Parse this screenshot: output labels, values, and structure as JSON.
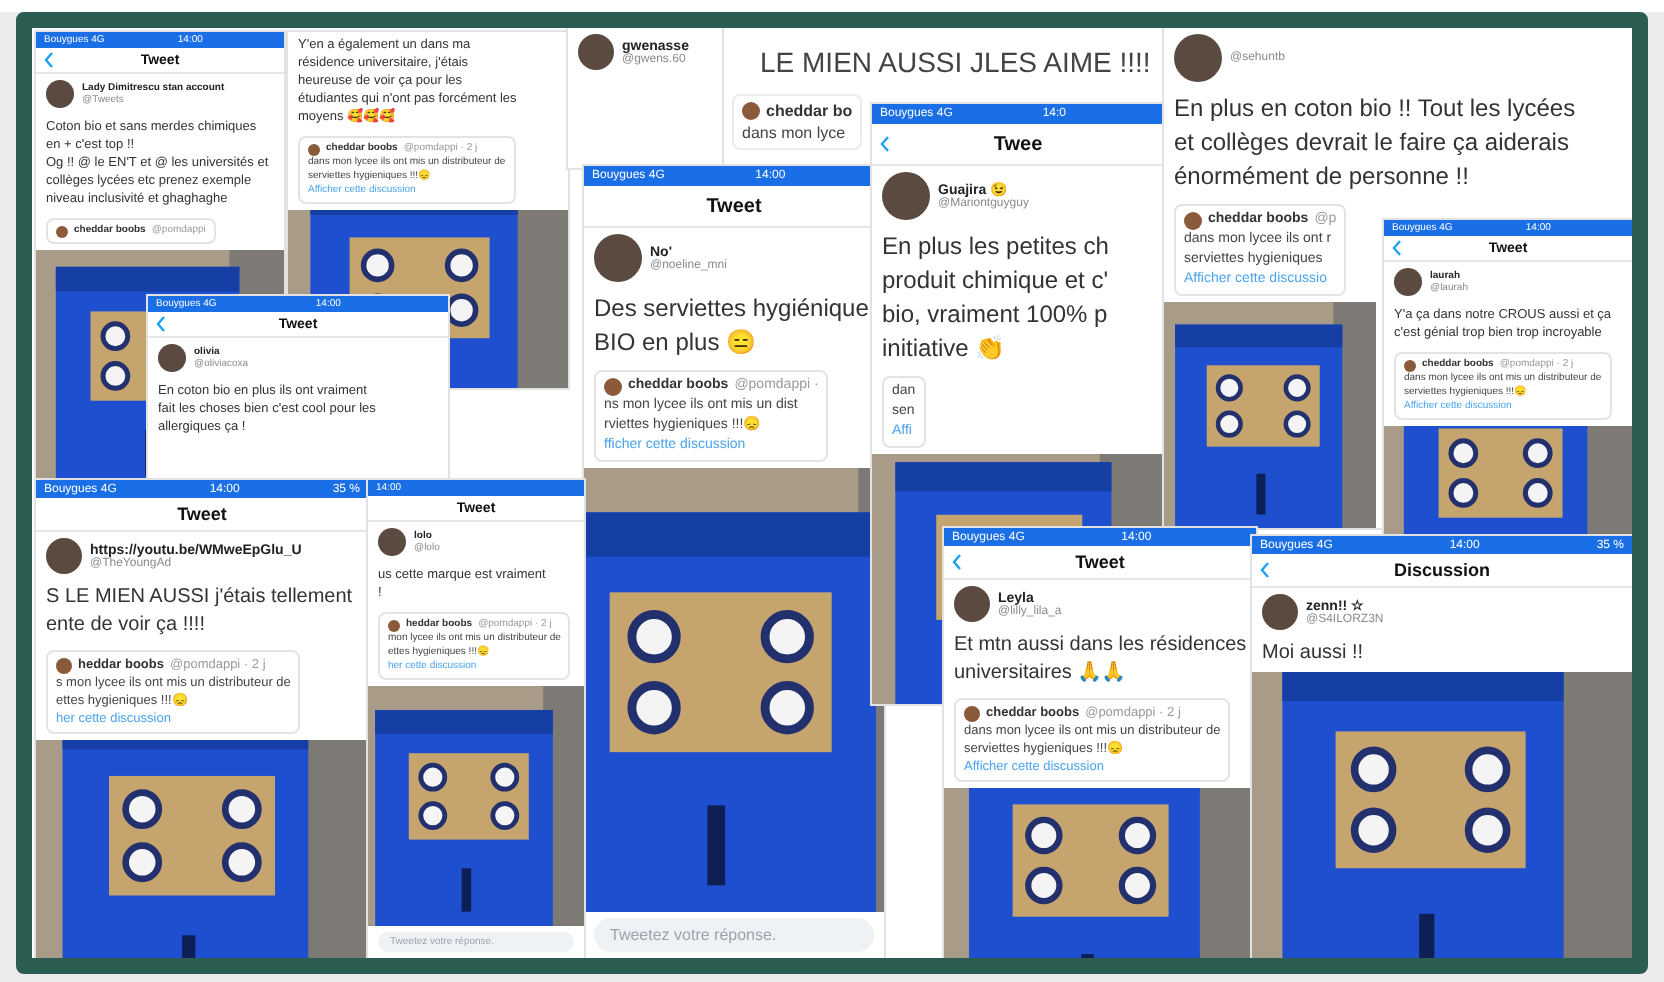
{
  "screenshots": [
    {
      "status": {
        "carrier": "Bouygues 4G",
        "time": "14:00"
      },
      "header": {
        "title": "Tweet",
        "back": true
      },
      "author": {
        "name": "Lady Dimitrescu stan account",
        "handle": "@Tweets"
      },
      "body": [
        "Coton bio et sans merdes chimiques",
        "en + c'est top !!",
        "Og !! @ le EN'T et @ les universités et",
        "collèges lycées etc prenez exemple",
        "niveau inclusivité et ghaghaghe"
      ],
      "quote": {
        "name": "cheddar boobs",
        "handle": "@pomdappi"
      },
      "photo": {
        "kind": "picture"
      }
    },
    {
      "body": [
        "Y'en a également un dans ma",
        "résidence universitaire, j'étais",
        "heureuse de voir ça pour les",
        "étudiantes qui n'ont pas forcément les",
        "moyens 🥰🥰🥰"
      ],
      "quote": {
        "name": "cheddar boobs",
        "handle": "@pomdappi · 2 j",
        "lines": [
          "dans mon lycee ils ont mis un distributeur de",
          "serviettes hygieniques !!!😞"
        ],
        "link": "Afficher cette discussion"
      },
      "photo": {
        "kind": "picture"
      }
    },
    {
      "author": {
        "name": "gwenasse",
        "handle": "@gwens.60"
      }
    },
    {
      "body": [
        "LE MIEN AUSSI JLES AIME !!!!"
      ],
      "quote": {
        "name": "cheddar bo",
        "lines": [
          "dans mon lyce"
        ]
      }
    },
    {
      "status": {
        "carrier": "Bouygues 4G",
        "time": "14:00"
      },
      "header": {
        "title": "Tweet",
        "back": false
      },
      "author": {
        "name": "No'",
        "handle": "@noeline_mni"
      },
      "body": [
        "Des serviettes hygiénique",
        "BIO en plus 😑"
      ],
      "quote": {
        "name": "cheddar boobs",
        "handle": "@pomdappi ·",
        "lines": [
          "ns mon lycee ils ont mis un dist",
          "rviettes hygieniques !!!😞"
        ],
        "link": "fficher cette discussion"
      },
      "photo": {
        "kind": "picture"
      },
      "reply": {
        "placeholder": "Tweetez votre réponse."
      }
    },
    {
      "status": {
        "carrier": "Bouygues 4G",
        "time": "14:0"
      },
      "header": {
        "title": "Twee",
        "back": true
      },
      "author": {
        "name": "Guajira 😉",
        "handle": "@Mariontguyguy"
      },
      "body": [
        "En plus les petites ch",
        "produit chimique et c'",
        "bio, vraiment 100% p",
        "initiative 👏"
      ],
      "quote": {
        "lines": [
          "dan",
          "sen"
        ],
        "link": "Affi"
      },
      "photo": {
        "kind": "picture"
      }
    },
    {
      "author": {
        "handle": "@sehuntb"
      },
      "body": [
        "En plus en coton bio !! Tout les lycées",
        "et collèges devrait le faire ça aiderais",
        "énormément de personne !!"
      ],
      "quote": {
        "name": "cheddar boobs",
        "handle": "@p",
        "lines": [
          "dans mon lycee ils ont r",
          "serviettes hygieniques"
        ],
        "link": "Afficher cette discussio"
      },
      "photo": {
        "kind": "picture"
      }
    },
    {
      "status": {
        "carrier": "Bouygues 4G",
        "time": "14:00"
      },
      "header": {
        "title": "Tweet",
        "back": true
      },
      "author": {
        "name": "laurah",
        "handle": "@laurah"
      },
      "body": [
        "Y'a ça dans notre CROUS aussi et ça",
        "c'est génial trop bien trop incroyable"
      ],
      "quote": {
        "name": "cheddar boobs",
        "handle": "@pomdappi · 2 j",
        "lines": [
          "dans mon lycee ils ont mis un distributeur de",
          "serviettes hygieniques !!!😞"
        ],
        "link": "Afficher cette discussion"
      },
      "photo": {
        "kind": "picture"
      }
    },
    {
      "status": {
        "carrier": "Bouygues 4G",
        "time": "14:00"
      },
      "header": {
        "title": "Tweet",
        "back": true
      },
      "author": {
        "name": "olivia",
        "handle": "@oliviacoxa"
      },
      "body": [
        "En coton bio en plus ils ont vraiment",
        "fait les choses bien c'est cool pour les",
        "allergiques ça !"
      ]
    },
    {
      "status": {
        "carrier": "Bouygues 4G",
        "time": "14:00",
        "battery": "35 %"
      },
      "header": {
        "title": "Tweet",
        "back": false
      },
      "author": {
        "name": "https://youtu.be/WMweEpGlu_U",
        "handle": "@TheYoungAd"
      },
      "body": [
        "S LE MIEN AUSSI j'étais tellement",
        "ente de voir ça !!!!"
      ],
      "quote": {
        "name": "heddar boobs",
        "handle": "@pomdappi · 2 j",
        "lines": [
          "s mon lycee ils ont mis un distributeur de",
          "ettes hygieniques !!!😞"
        ],
        "link": "her cette discussion"
      },
      "photo": {
        "kind": "picture"
      }
    },
    {
      "status": {
        "time": "14:00"
      },
      "header": {
        "title": "Tweet",
        "back": false
      },
      "author": {
        "name": "lolo",
        "handle": "@lolo"
      },
      "body": [
        "us cette marque est vraiment",
        "!"
      ],
      "quote": {
        "name": "heddar boobs",
        "handle": "@pomdappi · 2 j",
        "lines": [
          "mon lycee ils ont mis un distributeur de",
          "ettes hygieniques !!!😞"
        ],
        "link": "her cette discussion"
      },
      "photo": {
        "kind": "picture"
      },
      "reply": {
        "placeholder": "Tweetez votre réponse."
      }
    },
    {
      "status": {
        "carrier": "Bouygues 4G",
        "time": "14:00"
      },
      "header": {
        "title": "Tweet",
        "back": true
      },
      "author": {
        "name": "Leyla",
        "handle": "@lilly_lila_a"
      },
      "body": [
        "Et mtn aussi dans les résidences",
        "universitaires 🙏🙏"
      ],
      "quote": {
        "name": "cheddar boobs",
        "handle": "@pomdappi · 2 j",
        "lines": [
          "dans mon lycee ils ont mis un distributeur de",
          "serviettes hygieniques !!!😞"
        ],
        "link": "Afficher cette discussion"
      },
      "photo": {
        "kind": "picture"
      }
    },
    {
      "status": {
        "carrier": "Bouygues 4G",
        "time": "14:00",
        "battery": "35 %"
      },
      "header": {
        "title": "Discussion",
        "back": true
      },
      "author": {
        "name": "zenn!! ☆",
        "handle": "@S4ILORZ3N"
      },
      "body": [
        "Moi aussi !!"
      ],
      "photo": {
        "kind": "picture"
      }
    }
  ]
}
